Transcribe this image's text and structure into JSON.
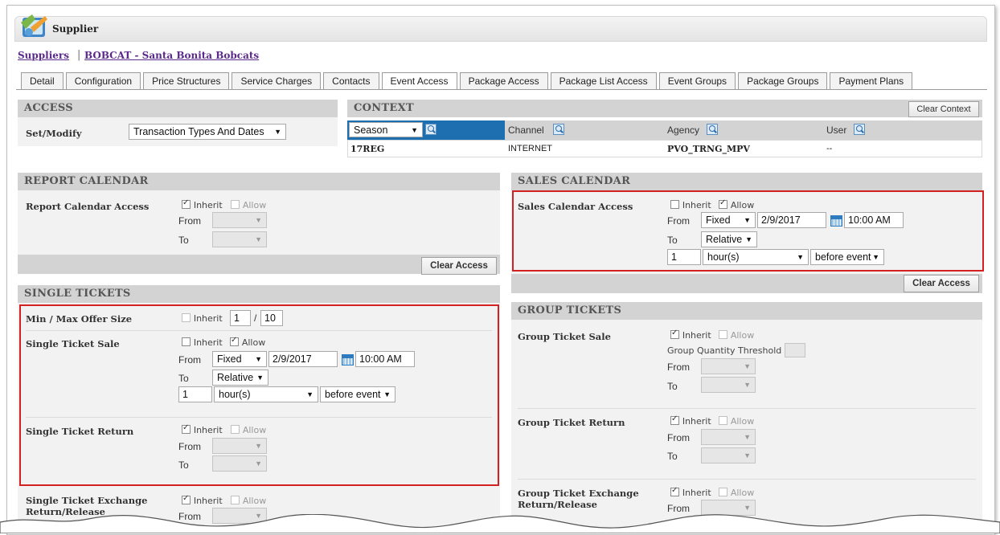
{
  "window": {
    "title": "Supplier"
  },
  "breadcrumb": {
    "root": "Suppliers",
    "current": "BOBCAT - Santa Bonita Bobcats"
  },
  "tabs": [
    "Detail",
    "Configuration",
    "Price Structures",
    "Service Charges",
    "Contacts",
    "Event Access",
    "Package Access",
    "Package List Access",
    "Event Groups",
    "Package Groups",
    "Payment Plans"
  ],
  "active_tab": "Event Access",
  "access": {
    "title": "ACCESS",
    "set_modify_label": "Set/Modify",
    "set_modify_value": "Transaction Types And Dates"
  },
  "context": {
    "title": "CONTEXT",
    "clear_button": "Clear Context",
    "columns": [
      {
        "label": "Season",
        "value": "17REG"
      },
      {
        "label": "Channel",
        "value": "INTERNET"
      },
      {
        "label": "Agency",
        "value": "PVO_TRNG_MPV"
      },
      {
        "label": "User",
        "value": "--"
      }
    ]
  },
  "report_calendar": {
    "title": "REPORT CALENDAR",
    "label": "Report Calendar Access",
    "inherit": "Inherit",
    "allow": "Allow",
    "from": "From",
    "to": "To",
    "clear_button": "Clear Access"
  },
  "sales_calendar": {
    "title": "SALES CALENDAR",
    "label": "Sales Calendar Access",
    "inherit": "Inherit",
    "allow": "Allow",
    "from": "From",
    "from_type": "Fixed",
    "from_date": "2/9/2017",
    "from_time": "10:00 AM",
    "to": "To",
    "to_type": "Relative",
    "offset_value": "1",
    "offset_unit": "hour(s)",
    "offset_rel": "before event",
    "clear_button": "Clear Access"
  },
  "single_tickets": {
    "title": "SINGLE TICKETS",
    "min_max_label": "Min / Max Offer Size",
    "inherit": "Inherit",
    "allow": "Allow",
    "min_value": "1",
    "slash": "/",
    "max_value": "10",
    "sale_label": "Single Ticket Sale",
    "from": "From",
    "to": "To",
    "sale_from_type": "Fixed",
    "sale_from_date": "2/9/2017",
    "sale_from_time": "10:00 AM",
    "sale_to_type": "Relative",
    "sale_offset_value": "1",
    "sale_offset_unit": "hour(s)",
    "sale_offset_rel": "before event",
    "return_label": "Single Ticket Return",
    "exchange_label_1": "Single Ticket Exchange",
    "exchange_label_2": "Return/Release"
  },
  "group_tickets": {
    "title": "GROUP TICKETS",
    "sale_label": "Group Ticket Sale",
    "inherit": "Inherit",
    "allow": "Allow",
    "threshold_label": "Group Quantity Threshold",
    "from": "From",
    "to": "To",
    "return_label": "Group Ticket Return",
    "exchange_label_1": "Group Ticket Exchange",
    "exchange_label_2": "Return/Release"
  },
  "colors": {
    "highlight_red": "#d42020",
    "context_selected": "#1e6fb0",
    "header_gray": "#d3d3d3",
    "link_purple": "#5a2a8a"
  }
}
